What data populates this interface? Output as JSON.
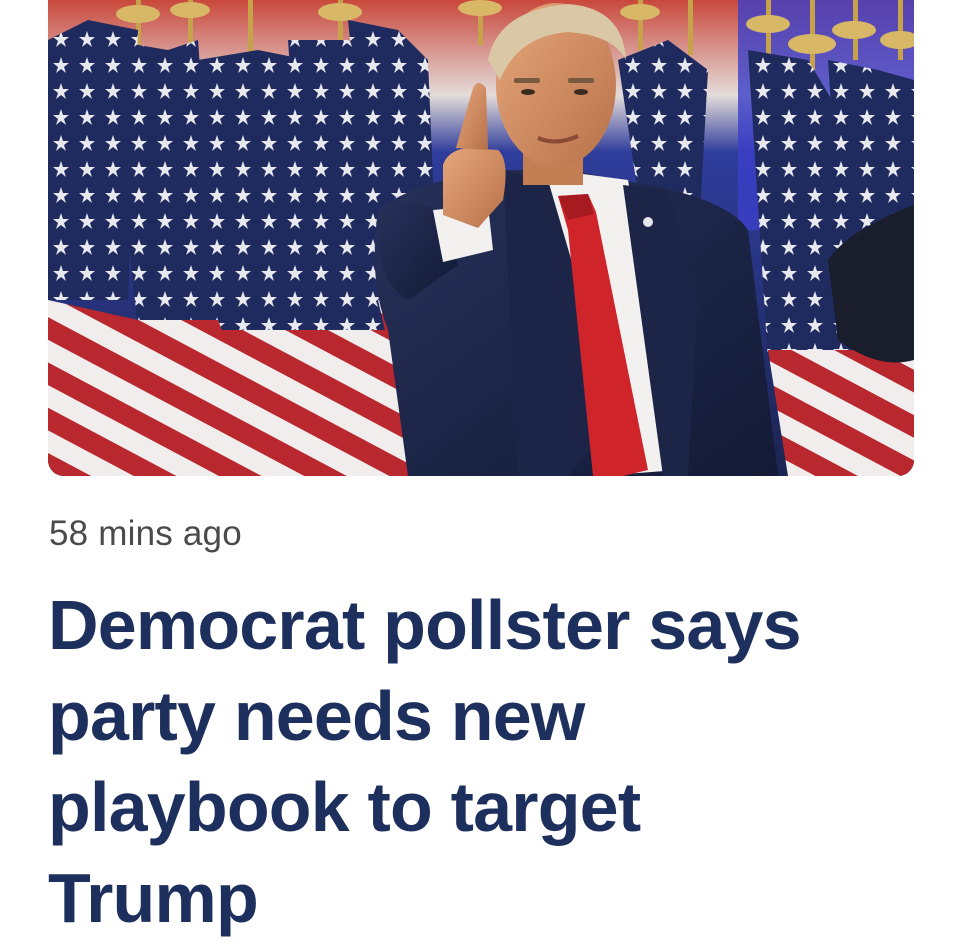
{
  "article": {
    "timestamp": "58 mins ago",
    "headline_lines": [
      "Democrat pollster says",
      "party needs new",
      "playbook to target",
      "Trump"
    ]
  },
  "hero_image": {
    "subject": "man in dark suit and red tie pointing at camera in front of American flags"
  },
  "colors": {
    "headline": "#1d2f5c",
    "timestamp": "#4a4a4a",
    "background": "#ffffff",
    "flag_red": "#b8282e",
    "flag_blue": "#1f2a5e",
    "tie_red": "#d0242b"
  }
}
